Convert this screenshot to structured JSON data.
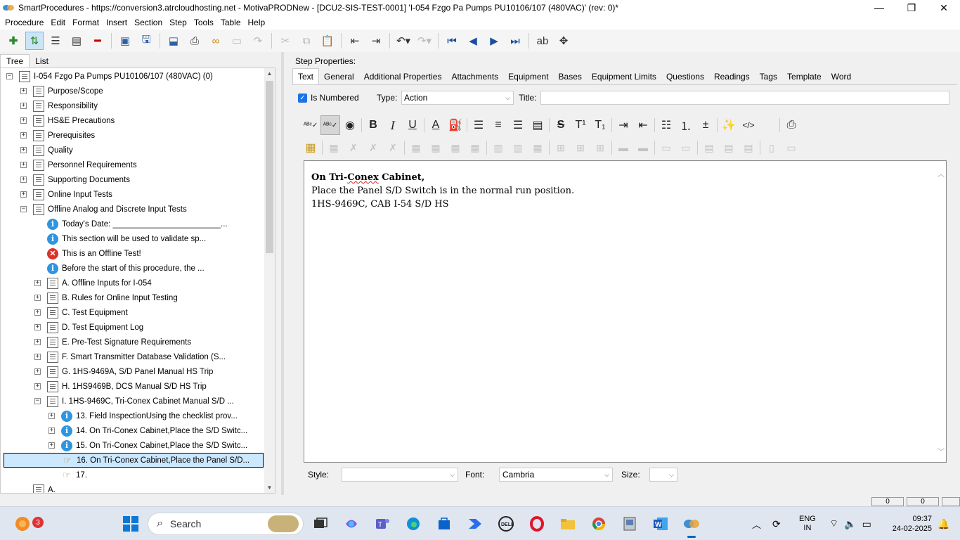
{
  "window": {
    "title": "SmartProcedures - https://conversion3.atrcloudhosting.net - MotivaPRODNew - [DCU2-SIS-TEST-0001] 'I-054 Fzgo Pa Pumps PU10106/107 (480VAC)' (rev: 0)*",
    "controls": [
      "—",
      "❐",
      "✕"
    ]
  },
  "menu": [
    "Procedure",
    "Edit",
    "Format",
    "Insert",
    "Section",
    "Step",
    "Tools",
    "Table",
    "Help"
  ],
  "left_tabs": [
    "Tree",
    "List"
  ],
  "tree": [
    {
      "label": "I-054 Fzgo Pa Pumps PU10106/107 (480VAC) (0)",
      "icon": "doc",
      "exp": "−",
      "indent": 0
    },
    {
      "label": "Purpose/Scope",
      "icon": "doc",
      "exp": "+",
      "indent": 1
    },
    {
      "label": "Responsibility",
      "icon": "doc",
      "exp": "+",
      "indent": 1
    },
    {
      "label": "HS&E Precautions",
      "icon": "doc",
      "exp": "+",
      "indent": 1
    },
    {
      "label": "Prerequisites",
      "icon": "doc",
      "exp": "+",
      "indent": 1
    },
    {
      "label": "Quality",
      "icon": "doc",
      "exp": "+",
      "indent": 1
    },
    {
      "label": "Personnel Requirements",
      "icon": "doc",
      "exp": "+",
      "indent": 1
    },
    {
      "label": "Supporting Documents",
      "icon": "doc",
      "exp": "+",
      "indent": 1
    },
    {
      "label": "Online Input Tests",
      "icon": "doc",
      "exp": "+",
      "indent": 1
    },
    {
      "label": "Offline Analog and Discrete Input Tests",
      "icon": "doc",
      "exp": "−",
      "indent": 1
    },
    {
      "label": "Today's Date: ________________________...",
      "icon": "info",
      "exp": "",
      "indent": 2
    },
    {
      "label": "This section will be used to validate sp...",
      "icon": "info",
      "exp": "",
      "indent": 2
    },
    {
      "label": "This is an Offline Test!",
      "icon": "error",
      "exp": "",
      "indent": 2
    },
    {
      "label": "Before the start of this procedure, the ...",
      "icon": "info",
      "exp": "",
      "indent": 2
    },
    {
      "label": "A. Offline Inputs for I-054",
      "icon": "doc",
      "exp": "+",
      "indent": 2
    },
    {
      "label": "B. Rules for Online Input Testing",
      "icon": "doc",
      "exp": "+",
      "indent": 2
    },
    {
      "label": "C. Test Equipment",
      "icon": "doc",
      "exp": "+",
      "indent": 2
    },
    {
      "label": "D. Test Equipment Log",
      "icon": "doc",
      "exp": "+",
      "indent": 2
    },
    {
      "label": "E. Pre-Test Signature Requirements",
      "icon": "doc",
      "exp": "+",
      "indent": 2
    },
    {
      "label": "F. Smart Transmitter Database Validation (S...",
      "icon": "doc",
      "exp": "+",
      "indent": 2
    },
    {
      "label": "G. 1HS-9469A, S/D Panel Manual HS Trip",
      "icon": "doc",
      "exp": "+",
      "indent": 2
    },
    {
      "label": "H. 1HS9469B, DCS Manual S/D HS Trip",
      "icon": "doc",
      "exp": "+",
      "indent": 2
    },
    {
      "label": "I. 1HS-9469C, Tri-Conex Cabinet Manual S/D ...",
      "icon": "doc",
      "exp": "−",
      "indent": 2
    },
    {
      "label": "13. Field InspectionUsing the checklist prov...",
      "icon": "info",
      "exp": "+",
      "indent": 3
    },
    {
      "label": "14. On Tri-Conex Cabinet,Place the S/D Switc...",
      "icon": "info",
      "exp": "+",
      "indent": 3
    },
    {
      "label": "15. On Tri-Conex Cabinet,Place the S/D Switc...",
      "icon": "info",
      "exp": "+",
      "indent": 3
    },
    {
      "label": "16. On Tri-Conex Cabinet,Place the Panel S/D...",
      "icon": "hand",
      "exp": "",
      "indent": 3,
      "selected": true
    },
    {
      "label": "17.",
      "icon": "hand",
      "exp": "",
      "indent": 3
    },
    {
      "label": "A.",
      "icon": "doc",
      "exp": "",
      "indent": 1
    }
  ],
  "right": {
    "step_properties_label": "Step Properties:",
    "tabs": [
      "Text",
      "General",
      "Additional Properties",
      "Attachments",
      "Equipment",
      "Bases",
      "Equipment Limits",
      "Questions",
      "Readings",
      "Tags",
      "Template",
      "Word"
    ],
    "is_numbered_label": "Is Numbered",
    "type_label": "Type:",
    "type_value": "Action",
    "title_label": "Title:",
    "title_value": "",
    "editor_lines": [
      {
        "pre": "On Tri-",
        "spell": "Conex",
        "post": " Cabinet,",
        "bold": true
      },
      {
        "pre": "Place the Panel S/D Switch is in the normal run position.",
        "spell": "",
        "post": "",
        "bold": false
      },
      {
        "pre": "1HS-9469C, CAB I-54 S/D HS",
        "spell": "",
        "post": "",
        "bold": false
      }
    ],
    "style_label": "Style:",
    "style_value": "",
    "font_label": "Font:",
    "font_value": "Cambria",
    "size_label": "Size:",
    "size_value": ""
  },
  "status": {
    "box1": "0",
    "box2": "0"
  },
  "taskbar": {
    "search_label": "Search",
    "notif_count": "3",
    "lang_line1": "ENG",
    "lang_line2": "IN",
    "time": "09:37",
    "date": "24-02-2025"
  }
}
